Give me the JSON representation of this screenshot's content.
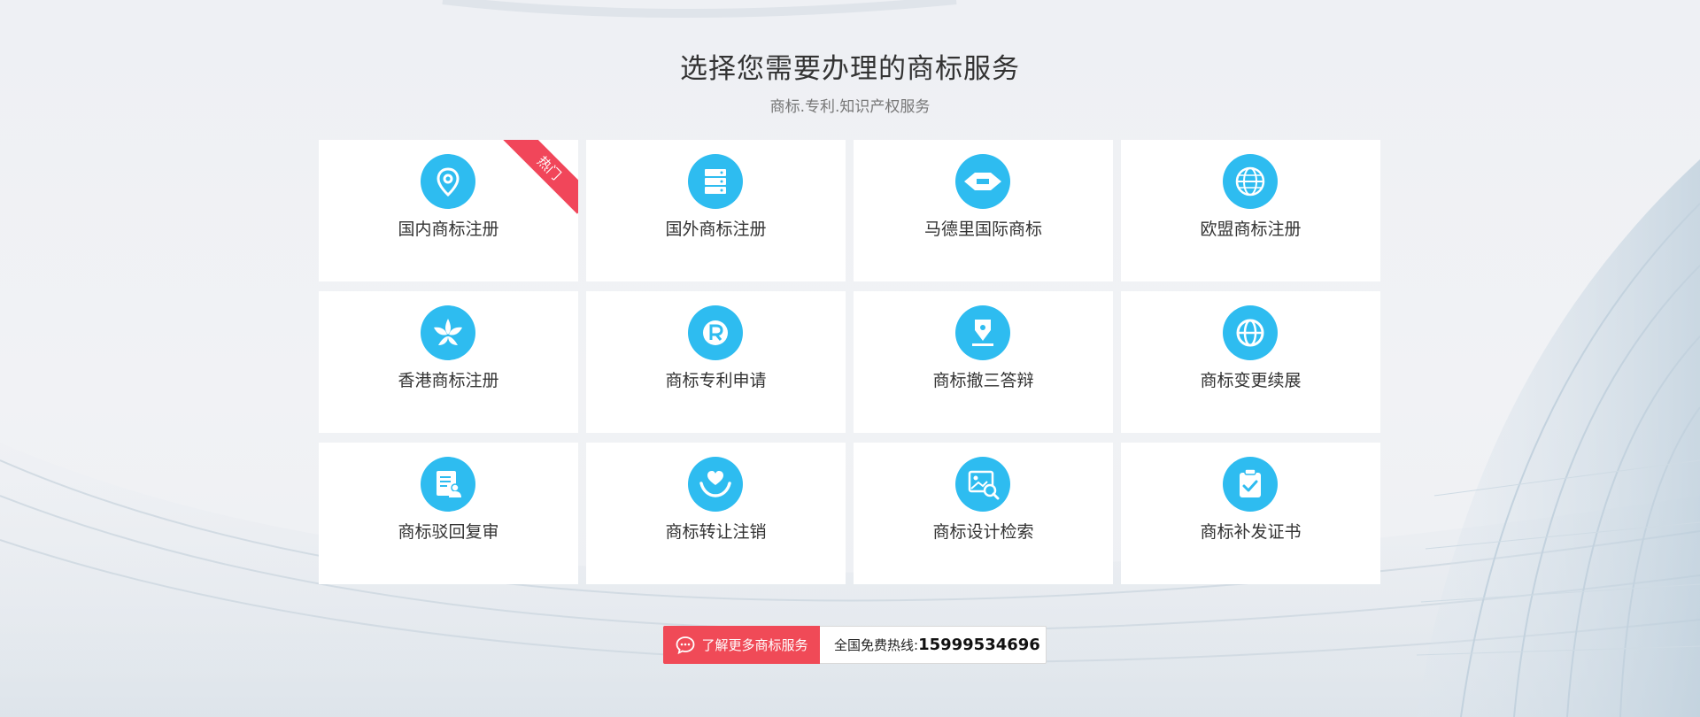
{
  "header": {
    "title": "选择您需要办理的商标服务",
    "subtitle": "商标.专利.知识产权服务"
  },
  "services": [
    {
      "label": "国内商标注册",
      "icon": "location-pin-icon",
      "badge": "热门"
    },
    {
      "label": "国外商标注册",
      "icon": "server-stack-icon"
    },
    {
      "label": "马德里国际商标",
      "icon": "madrid-badge-icon"
    },
    {
      "label": "欧盟商标注册",
      "icon": "eu-globe-icon"
    },
    {
      "label": "香港商标注册",
      "icon": "bauhinia-flower-icon"
    },
    {
      "label": "商标专利申请",
      "icon": "registered-r-icon"
    },
    {
      "label": "商标撤三答辩",
      "icon": "pen-nib-icon"
    },
    {
      "label": "商标变更续展",
      "icon": "globe-icon"
    },
    {
      "label": "商标驳回复审",
      "icon": "document-person-icon"
    },
    {
      "label": "商标转让注销",
      "icon": "heart-hands-icon"
    },
    {
      "label": "商标设计检索",
      "icon": "image-search-icon"
    },
    {
      "label": "商标补发证书",
      "icon": "clipboard-check-icon"
    }
  ],
  "footer": {
    "more_button": "了解更多商标服务",
    "hotline_label": "全国免费热线:",
    "hotline_number": "15999534696"
  },
  "colors": {
    "accent": "#2ebcf0",
    "hot_badge": "#f1465a",
    "cta": "#f04a57"
  }
}
